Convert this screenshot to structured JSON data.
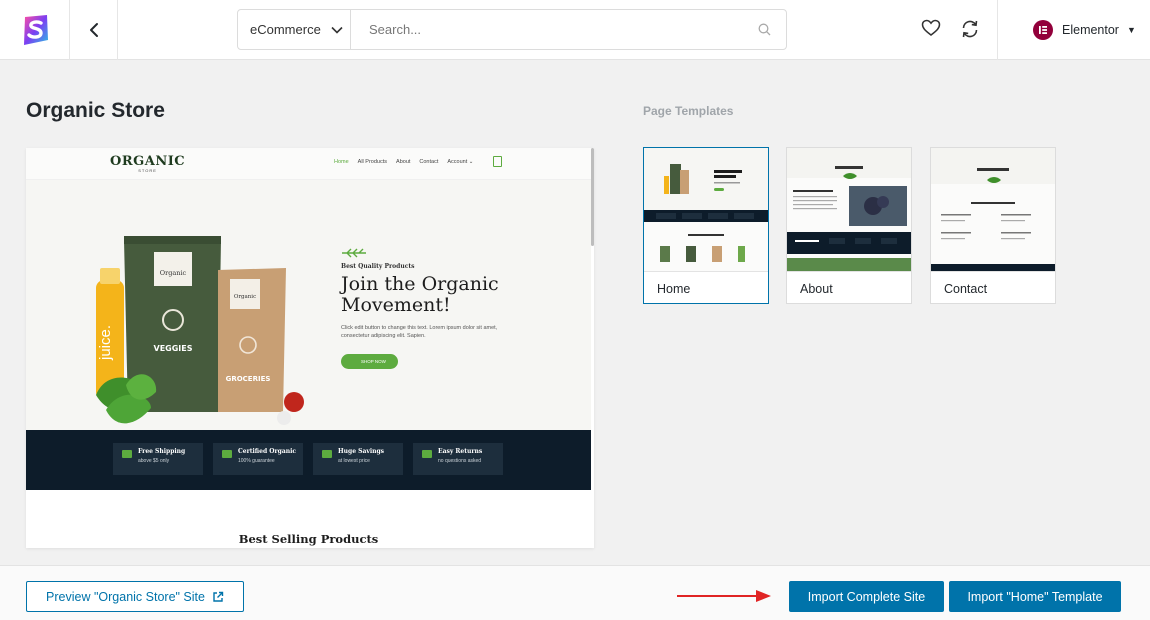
{
  "header": {
    "category_select": "eCommerce",
    "search_placeholder": "Search...",
    "builder": "Elementor",
    "icons": [
      "app-logo-icon",
      "back-arrow-icon",
      "chevron-down-icon",
      "search-icon",
      "heart-icon",
      "sync-icon",
      "elementor-icon"
    ]
  },
  "site": {
    "title": "Organic Store"
  },
  "preview": {
    "logo": "ORGANIC",
    "logo_sub": "STORE",
    "nav": [
      "Home",
      "All Products",
      "About",
      "Contact",
      "Account ⌄"
    ],
    "hero_tag": "Best Quality Products",
    "hero_heading_line1": "Join the Organic",
    "hero_heading_line2": "Movement!",
    "hero_desc": "Click edit button to change this text. Lorem ipsum dolor sit amet, consectetur adipiscing elit. Sapien.",
    "shop_button": "SHOP NOW",
    "package_labels": [
      "Organic",
      "VEGGIES",
      "Organic",
      "GROCERIES",
      "juice."
    ],
    "features": [
      {
        "title": "Free Shipping",
        "sub": "above $5 only"
      },
      {
        "title": "Certified Organic",
        "sub": "100% guarantee"
      },
      {
        "title": "Huge Savings",
        "sub": "at lowest price"
      },
      {
        "title": "Easy Returns",
        "sub": "no questions asked"
      }
    ],
    "best_selling": "Best Selling Products"
  },
  "templates": {
    "label": "Page Templates",
    "items": [
      {
        "name": "Home",
        "selected": true
      },
      {
        "name": "About",
        "selected": false
      },
      {
        "name": "Contact",
        "selected": false
      }
    ]
  },
  "footer": {
    "preview_button": "Preview \"Organic Store\" Site",
    "import_site_button": "Import Complete Site",
    "import_home_button": "Import \"Home\" Template"
  },
  "colors": {
    "accent": "#0073aa",
    "green": "#5dab3f",
    "dark_navy": "#0d1c2a",
    "arrow": "#e02424"
  }
}
